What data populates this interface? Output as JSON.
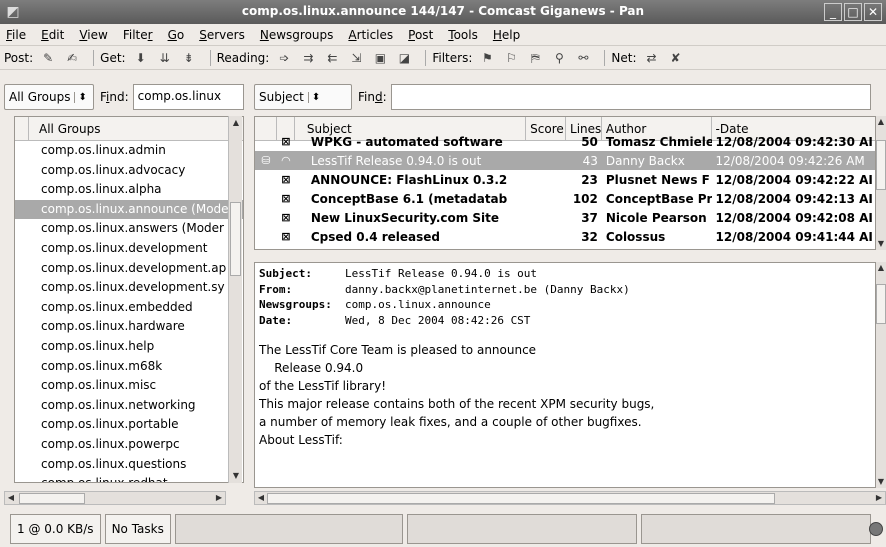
{
  "window": {
    "title": "comp.os.linux.announce 144/147 -  Comcast Giganews - Pan",
    "controls": [
      "_",
      "□",
      "✕"
    ]
  },
  "menu": [
    {
      "key": "F",
      "rest": "ile"
    },
    {
      "key": "E",
      "rest": "dit"
    },
    {
      "key": "V",
      "rest": "iew"
    },
    {
      "pre": "Filte",
      "key": "r",
      "rest": ""
    },
    {
      "key": "G",
      "rest": "o"
    },
    {
      "key": "S",
      "rest": "ervers"
    },
    {
      "key": "N",
      "rest": "ewsgroups"
    },
    {
      "key": "A",
      "rest": "rticles"
    },
    {
      "key": "P",
      "rest": "ost"
    },
    {
      "key": "T",
      "rest": "ools"
    },
    {
      "key": "H",
      "rest": "elp"
    }
  ],
  "toolbar": {
    "post_label": "Post:",
    "get_label": "Get:",
    "reading_label": "Reading:",
    "filters_label": "Filters:",
    "net_label": "Net:"
  },
  "groups_filter": {
    "combo": "All Groups",
    "find_pre": "F",
    "find_key": "i",
    "find_rest": "nd:",
    "find_value": "comp.os.linux"
  },
  "group_list": {
    "header": "All Groups",
    "items": [
      "comp.os.linux.admin",
      "comp.os.linux.advocacy",
      "comp.os.linux.alpha",
      "comp.os.linux.announce (Mode",
      "comp.os.linux.answers (Moder",
      "comp.os.linux.development",
      "comp.os.linux.development.ap",
      "comp.os.linux.development.sy",
      "comp.os.linux.embedded",
      "comp.os.linux.hardware",
      "comp.os.linux.help",
      "comp.os.linux.m68k",
      "comp.os.linux.misc",
      "comp.os.linux.networking",
      "comp.os.linux.portable",
      "comp.os.linux.powerpc",
      "comp.os.linux.questions",
      "comp.os.linux.redhat"
    ],
    "selected_index": 3
  },
  "header_filter": {
    "combo": "Subject",
    "find_pre": "Fin",
    "find_key": "d",
    "find_rest": ":",
    "find_value": ""
  },
  "article_list": {
    "columns": [
      "Subject",
      "Score",
      "Lines",
      "Author",
      "-Date"
    ],
    "rows": [
      {
        "subject": "WPKG - automated software",
        "score": "",
        "lines": "50",
        "author": "Tomasz Chmiele",
        "date": "12/08/2004 09:42:30 AI",
        "state": "",
        "env": "⊠"
      },
      {
        "subject": "LessTif Release 0.94.0 is out",
        "score": "",
        "lines": "43",
        "author": "Danny Backx",
        "date": "12/08/2004 09:42:26 AM",
        "state": "⛁",
        "env": "◠"
      },
      {
        "subject": "ANNOUNCE: FlashLinux 0.3.2",
        "score": "",
        "lines": "23",
        "author": "Plusnet News F",
        "date": "12/08/2004 09:42:22 AI",
        "state": "",
        "env": "⊠"
      },
      {
        "subject": "ConceptBase 6.1 (metadatab",
        "score": "",
        "lines": "102",
        "author": "ConceptBase Pr",
        "date": "12/08/2004 09:42:13 AI",
        "state": "",
        "env": "⊠"
      },
      {
        "subject": "New LinuxSecurity.com Site",
        "score": "",
        "lines": "37",
        "author": "Nicole Pearson",
        "date": "12/08/2004 09:42:08 AI",
        "state": "",
        "env": "⊠"
      },
      {
        "subject": "Cpsed 0.4 released",
        "score": "",
        "lines": "32",
        "author": "Colossus",
        "date": "12/08/2004 09:41:44 AI",
        "state": "",
        "env": "⊠"
      }
    ],
    "selected_index": 1
  },
  "article": {
    "headers": [
      {
        "key": "Subject:",
        "value": "LessTif Release 0.94.0 is out"
      },
      {
        "key": "From:",
        "value": "danny.backx@planetinternet.be (Danny Backx)"
      },
      {
        "key": "Newsgroups:",
        "value": "comp.os.linux.announce"
      },
      {
        "key": "Date:",
        "value": "Wed, 8 Dec 2004 08:42:26 CST"
      }
    ],
    "body": [
      "The LessTif Core Team is pleased to announce",
      "    Release 0.94.0",
      "of the LessTif library!",
      "",
      "This major release contains both of the recent XPM security bugs,",
      "a number of memory leak fixes, and a couple of other bugfixes.",
      "",
      "About LessTif:"
    ]
  },
  "status": {
    "rate": "1 @ 0.0 KB/s",
    "tasks": "No Tasks"
  }
}
